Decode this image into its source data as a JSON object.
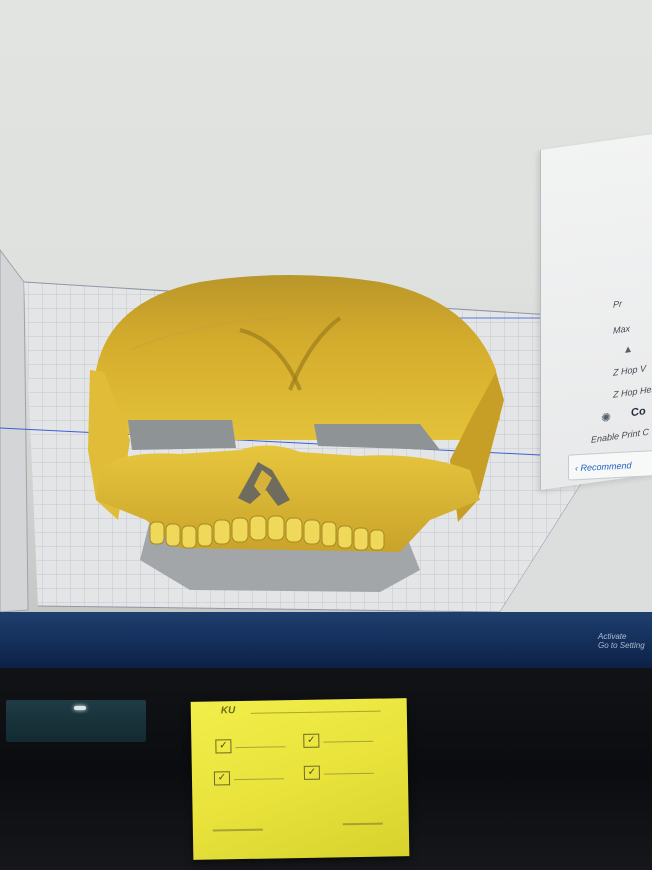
{
  "slicer": {
    "viewport": {
      "model": "skull",
      "model_color": "#d9b12a",
      "shadow_color": "#a3a6a8",
      "grid_color": "#c9cbd0",
      "axis_color": "#3a5fd6"
    },
    "settings_panel": {
      "rows": [
        "Pr",
        "Max",
        "Z Hop V",
        "Z Hop Hei",
        "Co",
        "Enable Print C"
      ],
      "recommended_label": "Recommend"
    }
  },
  "taskbar": {
    "activate_line1": "Activate",
    "activate_line2": "Go to Setting"
  },
  "sticky_note": {
    "header": "KU",
    "color": "#ece63e"
  },
  "colors": {
    "screen_bg": "#e0e2e0",
    "taskbar": "#163360",
    "bezel": "#0c0e12"
  }
}
